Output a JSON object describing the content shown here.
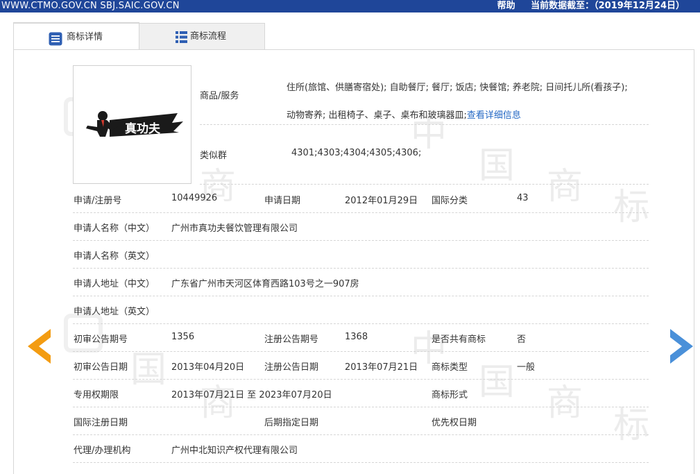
{
  "topbar": {
    "sites": "WWW.CTMO.GOV.CN SBJ.SAIC.GOV.CN",
    "help": "帮助",
    "data_date": "当前数据截至：（2019年12月24日）"
  },
  "tabs": [
    {
      "label": "商标详情",
      "icon": "list-detail-icon"
    },
    {
      "label": "商标流程",
      "icon": "list-flow-icon"
    }
  ],
  "logo": {
    "text": "真功夫"
  },
  "goods": {
    "label": "商品/服务",
    "text_line1": "住所(旅馆、供膳寄宿处); 自助餐厅; 餐厅; 饭店; 快餐馆; 养老院; 日间托儿所(看孩子);",
    "text_line2": "动物寄养; 出租椅子、桌子、桌布和玻璃器皿;",
    "link": "查看详细信息"
  },
  "similar_group": {
    "label": "类似群",
    "value": "4301;4303;4304;4305;4306;"
  },
  "fields": {
    "reg_no_label": "申请/注册号",
    "reg_no": "10449926",
    "apply_date_label": "申请日期",
    "apply_date": "2012年01月29日",
    "intl_class_label": "国际分类",
    "intl_class": "43",
    "applicant_cn_label": "申请人名称（中文）",
    "applicant_cn": "广州市真功夫餐饮管理有限公司",
    "applicant_en_label": "申请人名称（英文）",
    "applicant_en": "",
    "address_cn_label": "申请人地址（中文）",
    "address_cn": "广东省广州市天河区体育西路103号之一907房",
    "address_en_label": "申请人地址（英文）",
    "address_en": "",
    "prelim_no_label": "初审公告期号",
    "prelim_no": "1356",
    "reg_pub_no_label": "注册公告期号",
    "reg_pub_no": "1368",
    "shared_label": "是否共有商标",
    "shared": "否",
    "prelim_date_label": "初审公告日期",
    "prelim_date": "2013年04月20日",
    "reg_pub_date_label": "注册公告日期",
    "reg_pub_date": "2013年07月21日",
    "mark_type_label": "商标类型",
    "mark_type": "一般",
    "exclusive_label": "专用权期限",
    "exclusive": "2013年07月21日 至 2023年07月20日",
    "mark_form_label": "商标形式",
    "mark_form": "",
    "intl_reg_date_label": "国际注册日期",
    "intl_reg_date": "",
    "later_date_label": "后期指定日期",
    "later_date": "",
    "priority_date_label": "优先权日期",
    "priority_date": "",
    "agent_label": "代理/办理机构",
    "agent": "广州中北知识产权代理有限公司"
  },
  "colors": {
    "topbar": "#1f4699",
    "link": "#2468c4",
    "prev_arrow": "#f39c12",
    "next_arrow": "#4a90d9"
  },
  "watermark": {
    "chars": [
      "中",
      "国",
      "商",
      "标"
    ]
  }
}
